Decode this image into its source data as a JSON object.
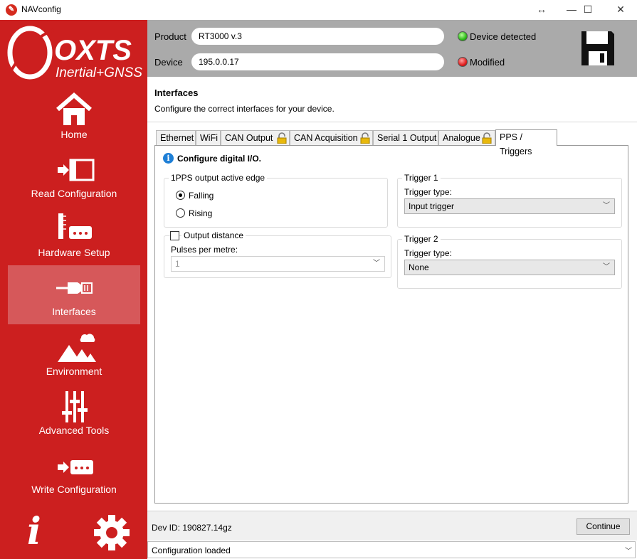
{
  "window": {
    "title": "NAVconfig",
    "resize_glyph": "↔",
    "minimize_glyph": "—",
    "maximize_glyph": "☐",
    "close_glyph": "✕"
  },
  "brand": {
    "name": "OXTS",
    "tagline": "Inertial+GNSS",
    "color": "#cc1f1f"
  },
  "sidebar": {
    "items": [
      {
        "label": "Home",
        "icon": "home-icon"
      },
      {
        "label": "Read Configuration",
        "icon": "read-config-icon"
      },
      {
        "label": "Hardware Setup",
        "icon": "hardware-setup-icon"
      },
      {
        "label": "Interfaces",
        "icon": "interfaces-icon",
        "active": true
      },
      {
        "label": "Environment",
        "icon": "environment-icon"
      },
      {
        "label": "Advanced Tools",
        "icon": "advanced-tools-icon"
      },
      {
        "label": "Write Configuration",
        "icon": "write-config-icon"
      }
    ],
    "bottom": {
      "info_glyph": "i",
      "settings_icon": "gear-icon"
    }
  },
  "header": {
    "product_label": "Product",
    "product_value": "RT3000 v.3",
    "device_label": "Device",
    "device_value": "195.0.0.17",
    "status1": "Device detected",
    "status2": "Modified",
    "save_icon": "floppy-disk-icon"
  },
  "page": {
    "title": "Interfaces",
    "subtitle": "Configure the correct interfaces for your device."
  },
  "tabs": [
    {
      "label": "Ethernet",
      "locked": false
    },
    {
      "label": "WiFi",
      "locked": false
    },
    {
      "label": "CAN Output",
      "locked": true
    },
    {
      "label": "CAN Acquisition",
      "locked": true
    },
    {
      "label": "Serial 1 Output",
      "locked": false
    },
    {
      "label": "Analogue",
      "locked": true
    },
    {
      "label": "PPS / Triggers",
      "locked": false,
      "active": true
    }
  ],
  "panel": {
    "info": "Configure digital I/O.",
    "pps": {
      "title": "1PPS output active edge",
      "options": [
        "Falling",
        "Rising"
      ],
      "selected": "Falling"
    },
    "distance": {
      "checkbox_label": "Output distance",
      "checked": false,
      "pulses_label": "Pulses per metre:",
      "pulses_value": "1"
    },
    "trigger1": {
      "title": "Trigger 1",
      "type_label": "Trigger type:",
      "type_value": "Input trigger"
    },
    "trigger2": {
      "title": "Trigger 2",
      "type_label": "Trigger type:",
      "type_value": "None"
    }
  },
  "footer": {
    "dev_id": "Dev ID: 190827.14gz",
    "continue_label": "Continue",
    "status": "Configuration loaded"
  }
}
